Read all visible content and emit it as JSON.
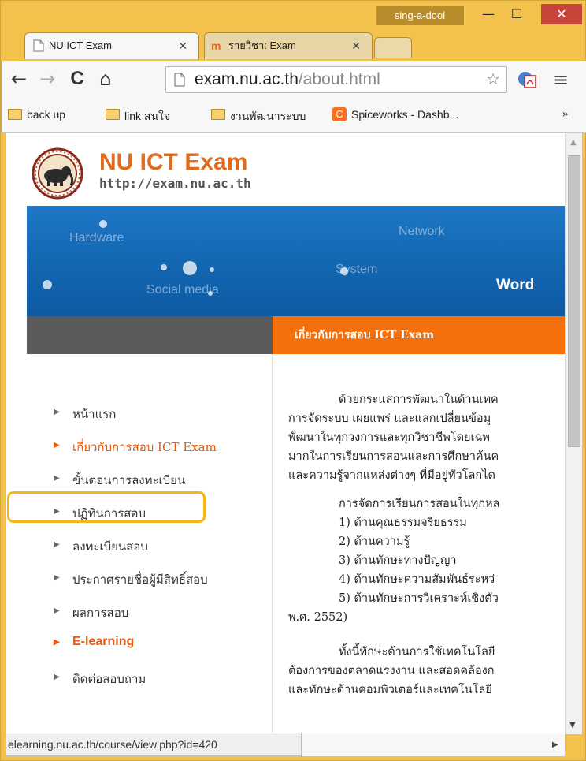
{
  "window": {
    "user_chip": "sing-a-dool",
    "minimize": "—",
    "maximize": "☐",
    "close": "✕"
  },
  "tabs": [
    {
      "label": "NU ICT Exam",
      "close": "✕"
    },
    {
      "label": "รายวิชา: Exam",
      "close": "✕",
      "favicon": "m"
    }
  ],
  "toolbar": {
    "back": "←",
    "forward": "→",
    "reload": "C",
    "home": "⌂",
    "url_host": "exam.nu.ac.th",
    "url_path": "/about.html",
    "star": "☆",
    "menu": "≡"
  },
  "bookmarks": [
    {
      "label": "back up",
      "icon": "folder-icon"
    },
    {
      "label": "link สนใจ",
      "icon": "folder-icon"
    },
    {
      "label": "งานพัฒนาระบบ",
      "icon": "folder-icon"
    },
    {
      "label": "Spiceworks - Dashb...",
      "icon": "spiceworks-icon"
    }
  ],
  "bookmarks_more": "»",
  "site": {
    "title": "NU ICT Exam",
    "url": "http://exam.nu.ac.th"
  },
  "banner": {
    "words": [
      "Hardware",
      "Network",
      "System",
      "Social media",
      "Word"
    ]
  },
  "section_title": "เกี่ยวกับการสอบ ICT Exam",
  "nav": [
    {
      "label": "หน้าแรก"
    },
    {
      "label": "เกี่ยวกับการสอบ ICT Exam",
      "active": true
    },
    {
      "label": "ขั้นตอนการลงทะเบียน"
    },
    {
      "label": "ปฏิทินการสอบ"
    },
    {
      "label": "ลงทะเบียนสอบ"
    },
    {
      "label": "ประกาศรายชื่อผู้มีสิทธิ์สอบ"
    },
    {
      "label": "ผลการสอบ"
    },
    {
      "label": "E-learning",
      "highlighted": true
    },
    {
      "label": "ติดต่อสอบถาม"
    }
  ],
  "content": {
    "p1": [
      "ด้วยกระแสการพัฒนาในด้านเทค",
      "การจัดระบบ เผยแพร่ และแลกเปลี่ยนข้อมู",
      "พัฒนาในทุกวงการและทุกวิชาชีพโดยเฉพ",
      "มากในการเรียนการสอนและการศึกษาค้นค",
      "และความรู้จากแหล่งต่างๆ ที่มีอยู่ทั่วโลกได"
    ],
    "p2": [
      "การจัดการเรียนการสอนในทุกหล",
      "1) ด้านคุณธรรมจริยธรรม",
      "2) ด้านความรู้",
      "3) ด้านทักษะทางปัญญา",
      "4) ด้านทักษะความสัมพันธ์ระหว่",
      "5) ด้านทักษะการวิเคราะห์เชิงตัว",
      "พ.ศ. 2552)"
    ],
    "p3": [
      "ทั้งนี้ทักษะด้านการใช้เทคโนโลยี",
      "ต้องการของตลาดแรงงาน และสอดคล้องก",
      "และทักษะด้านคอมพิวเตอร์และเทคโนโลยี"
    ]
  },
  "status_url": "elearning.nu.ac.th/course/view.php?id=420",
  "colors": {
    "accent": "#e8590b",
    "highlight": "#f6b716",
    "banner": "#1468b4"
  }
}
